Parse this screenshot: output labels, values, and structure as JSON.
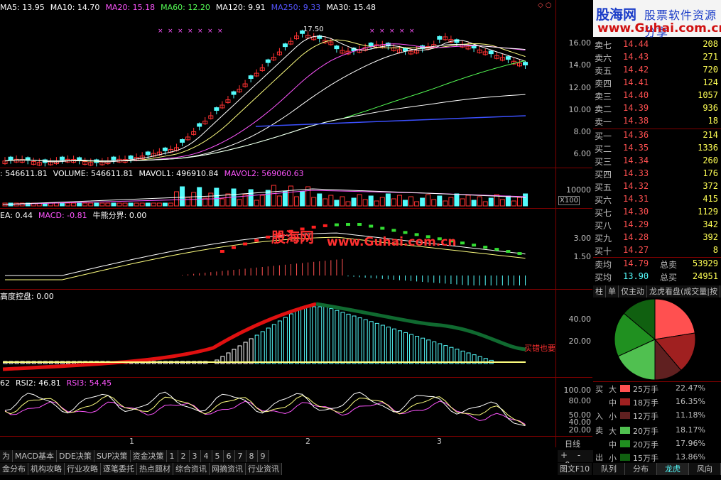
{
  "colors": {
    "up": "#ff3232",
    "down": "#54fcfc",
    "ma5": "#ffffff",
    "ma10": "#ffff00",
    "ma20": "#ff00ff",
    "ma60": "#00ff00",
    "ma120": "#ffffff",
    "ma250": "#3c50ff",
    "ma30": "#ffffff"
  },
  "main": {
    "ma_legend": [
      {
        "label": "MA5: 13.95",
        "color": "#ffffff"
      },
      {
        "label": "MA10: 14.70",
        "color": "#ffffff"
      },
      {
        "label": "MA20: 15.18",
        "color": "#ff55ff"
      },
      {
        "label": "MA60: 12.20",
        "color": "#55ff55"
      },
      {
        "label": "MA120: 9.91",
        "color": "#ffffff"
      },
      {
        "label": "MA250: 9.33",
        "color": "#5555ff"
      },
      {
        "label": "MA30: 15.48",
        "color": "#ffffff"
      }
    ],
    "price_high_label": "17.50",
    "y_ticks": [
      "16.00",
      "14.00",
      "12.00",
      "10.00",
      "8.00",
      "6.00"
    ],
    "window_controls": "◇ ○"
  },
  "volume": {
    "legend": [
      {
        "label": ": 546611.81",
        "color": "#ffffff"
      },
      {
        "label": "VOLUME: 546611.81",
        "color": "#ffffff"
      },
      {
        "label": "MAVOL1: 496910.84",
        "color": "#ffffff"
      },
      {
        "label": "MAVOL2: 569060.63",
        "color": "#ff55ff"
      }
    ],
    "y_tick": "10000",
    "unit": "X100"
  },
  "macd": {
    "legend": [
      {
        "label": "EA: 0.44",
        "color": "#ffffff"
      },
      {
        "label": "MACD: -0.81",
        "color": "#ff55ff"
      },
      {
        "label": "牛熊分界: 0.00",
        "color": "#ffffff"
      }
    ],
    "y_ticks": [
      "3.00",
      "1.50"
    ],
    "watermark": {
      "cn": "股海网",
      "url": "www.Guhai.com.cn"
    }
  },
  "control": {
    "legend": [
      {
        "label": "高度控盘: 0.00",
        "color": "#ffffff"
      }
    ],
    "y_ticks": [
      "40.00",
      "20.00"
    ],
    "annotation": "买错也要"
  },
  "rsi": {
    "legend": [
      {
        "label": "62",
        "color": "#ffffff"
      },
      {
        "label": "RSI2: 46.81",
        "color": "#ffffff"
      },
      {
        "label": "RSI3: 54.45",
        "color": "#ff55ff"
      }
    ],
    "y_ticks": [
      "100.00",
      "80.00",
      "50.00",
      "40.00",
      "20.00"
    ]
  },
  "time_axis": [
    "1",
    "2",
    "3"
  ],
  "bottom_tabs_row1": [
    "为",
    "MACD基本",
    "DDE决策",
    "SUP决策",
    "资金决策",
    "1",
    "2",
    "3",
    "4",
    "5",
    "6",
    "7",
    "8",
    "9"
  ],
  "bottom_tabs_row2": [
    "金分布",
    "机构攻略",
    "行业攻略",
    "逐笔委托",
    "热点题材",
    "综合资讯",
    "网摘资讯",
    "行业资讯"
  ],
  "right_bottom": {
    "period": "日线",
    "zoom_in": "+",
    "zoom_out": "-",
    "reset": "0",
    "f10": "图文F10",
    "tabs": [
      "队列",
      "分布",
      "龙虎",
      "风向"
    ]
  },
  "logo": {
    "cn": "股海网",
    "slogan": "股票软件资源分享",
    "url": "www.Guhai.com.cn"
  },
  "order_book": {
    "asks": [
      {
        "label": "卖七",
        "price": "14.44",
        "vol": "208"
      },
      {
        "label": "卖六",
        "price": "14.43",
        "vol": "271"
      },
      {
        "label": "卖五",
        "price": "14.42",
        "vol": "720"
      },
      {
        "label": "卖四",
        "price": "14.41",
        "vol": "124"
      },
      {
        "label": "卖三",
        "price": "14.40",
        "vol": "1057"
      },
      {
        "label": "卖二",
        "price": "14.39",
        "vol": "936"
      },
      {
        "label": "卖一",
        "price": "14.38",
        "vol": "18"
      }
    ],
    "bids": [
      {
        "label": "买一",
        "price": "14.36",
        "vol": "214"
      },
      {
        "label": "买二",
        "price": "14.35",
        "vol": "1336"
      },
      {
        "label": "买三",
        "price": "14.34",
        "vol": "260"
      },
      {
        "label": "买四",
        "price": "14.33",
        "vol": "176"
      },
      {
        "label": "买五",
        "price": "14.32",
        "vol": "372"
      },
      {
        "label": "买六",
        "price": "14.31",
        "vol": "415"
      },
      {
        "label": "买七",
        "price": "14.30",
        "vol": "1129"
      },
      {
        "label": "买八",
        "price": "14.29",
        "vol": "342"
      },
      {
        "label": "买九",
        "price": "14.28",
        "vol": "392"
      },
      {
        "label": "买十",
        "price": "14.27",
        "vol": "8"
      }
    ],
    "avg_sell": {
      "label": "卖均",
      "price": "14.79",
      "total_label": "总卖",
      "total": "53929"
    },
    "avg_buy": {
      "label": "买均",
      "price": "13.90",
      "total_label": "总买",
      "total": "24951"
    }
  },
  "pie_tabs": [
    "柱",
    "单",
    "仅主动",
    "龙虎看盘(成交量|按"
  ],
  "flow": {
    "buy_label": [
      "买",
      "入"
    ],
    "sell_label": [
      "卖",
      "出"
    ],
    "rows": [
      {
        "side": "buy",
        "size": "大",
        "color": "#ff5050",
        "amount": "25万手",
        "pct": "22.47%"
      },
      {
        "side": "buy",
        "size": "中",
        "color": "#a02020",
        "amount": "18万手",
        "pct": "16.35%"
      },
      {
        "side": "buy",
        "size": "小",
        "color": "#602020",
        "amount": "12万手",
        "pct": "11.18%"
      },
      {
        "side": "sell",
        "size": "大",
        "color": "#50c050",
        "amount": "20万手",
        "pct": "18.17%"
      },
      {
        "side": "sell",
        "size": "中",
        "color": "#209020",
        "amount": "20万手",
        "pct": "17.96%"
      },
      {
        "side": "sell",
        "size": "小",
        "color": "#106010",
        "amount": "15万手",
        "pct": "13.86%"
      }
    ]
  }
}
